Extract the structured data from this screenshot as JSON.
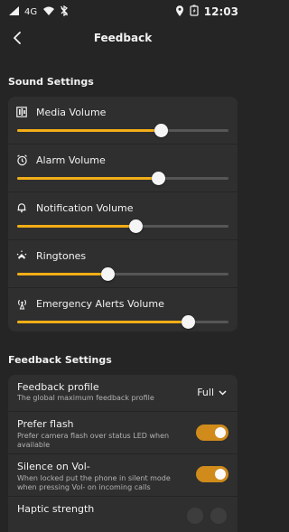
{
  "status_bar": {
    "network": "4G",
    "time": "12:03"
  },
  "header": {
    "title": "Feedback",
    "back_icon": "arrow-left-icon"
  },
  "sound_settings": {
    "title": "Sound Settings",
    "items": [
      {
        "label": "Media Volume",
        "icon": "music-icon",
        "value": 68
      },
      {
        "label": "Alarm Volume",
        "icon": "alarm-icon",
        "value": 67
      },
      {
        "label": "Notification Volume",
        "icon": "bell-icon",
        "value": 56
      },
      {
        "label": "Ringtones",
        "icon": "phone-ring-icon",
        "value": 43
      },
      {
        "label": "Emergency Alerts Volume",
        "icon": "broadcast-icon",
        "value": 81
      }
    ]
  },
  "feedback_settings": {
    "title": "Feedback Settings",
    "feedback_profile": {
      "title": "Feedback profile",
      "subtitle": "The global maximum feedback profile",
      "value": "Full"
    },
    "prefer_flash": {
      "title": "Prefer flash",
      "subtitle": "Prefer camera flash over status LED when available",
      "enabled": true
    },
    "silence_on_vol": {
      "title": "Silence on Vol-",
      "subtitle": "When locked put the phone in silent mode when pressing Vol- on incoming calls",
      "enabled": true
    },
    "haptic_strength": {
      "title": "Haptic strength"
    }
  },
  "colors": {
    "background": "#252525",
    "card": "#2f2f2f",
    "accent": "#f2ae17",
    "toggle": "#d08b1b"
  }
}
